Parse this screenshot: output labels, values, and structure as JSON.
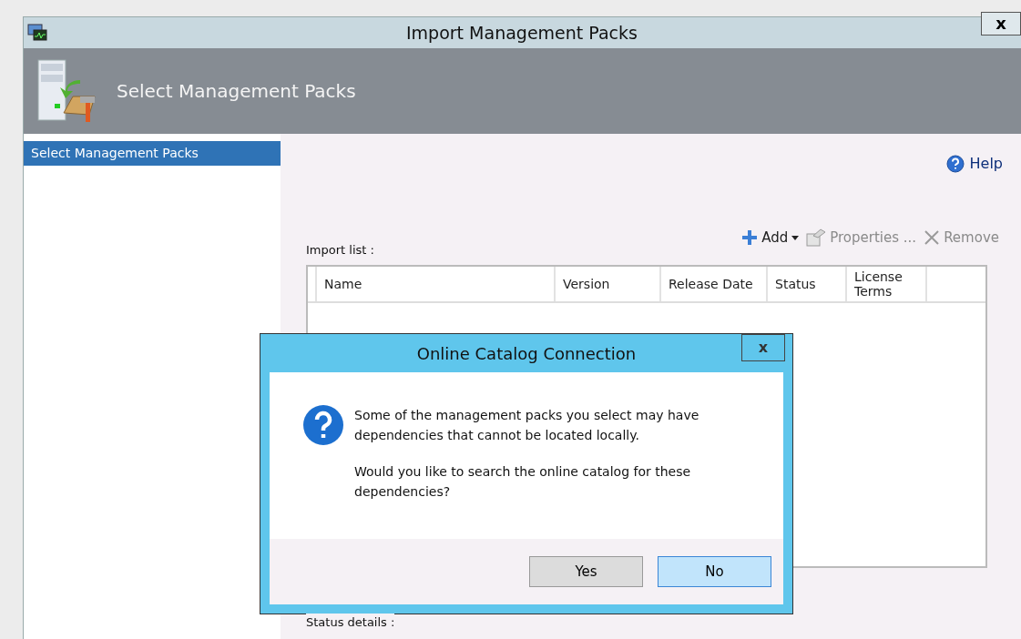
{
  "window": {
    "title": "Import Management Packs",
    "close": "x"
  },
  "header": {
    "title": "Select Management Packs"
  },
  "sidebar": {
    "items": [
      {
        "label": "Select Management Packs",
        "selected": true
      }
    ]
  },
  "help": "Help",
  "toolbar": [
    {
      "kind": "add",
      "label": "Add",
      "disabled": false
    },
    {
      "kind": "properties",
      "label": "Properties ...",
      "disabled": true
    },
    {
      "kind": "remove",
      "label": "Remove",
      "disabled": true
    }
  ],
  "import_list": {
    "label": "Import list :",
    "columns": [
      "Name",
      "Version",
      "Release Date",
      "Status",
      "License Terms",
      ""
    ]
  },
  "status_details": {
    "label": "Status details :"
  },
  "dialog": {
    "title": "Online Catalog Connection",
    "close": "x",
    "paragraphs": [
      "Some of the management packs you select may have dependencies that cannot be located locally.",
      "Would you like to search the online catalog for these dependencies?"
    ],
    "buttons": [
      {
        "label": "Yes",
        "focused": false
      },
      {
        "label": "No",
        "focused": true
      }
    ]
  }
}
